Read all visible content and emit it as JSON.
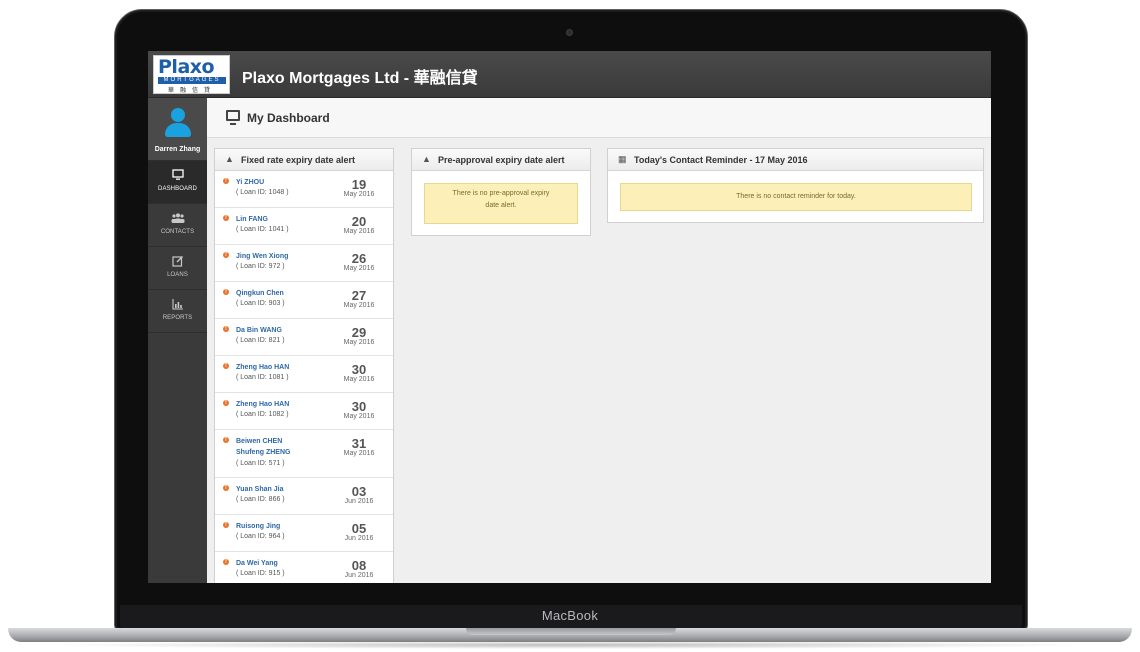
{
  "device": {
    "brand": "MacBook"
  },
  "header": {
    "logo": {
      "word": "Plaxo",
      "sub": "MORTGAGES",
      "cn": "華融信貸"
    },
    "title": "Plaxo Mortgages Ltd - 華融信貸"
  },
  "user": {
    "name": "Darren Zhang"
  },
  "nav": [
    {
      "label": "DASHBOARD",
      "icon": "monitor-icon",
      "active": true
    },
    {
      "label": "CONTACTS",
      "icon": "users-icon",
      "active": false
    },
    {
      "label": "LOANS",
      "icon": "edit-icon",
      "active": false
    },
    {
      "label": "REPORTS",
      "icon": "bar-chart-icon",
      "active": false
    }
  ],
  "page": {
    "title": "My Dashboard"
  },
  "fixed_rate_panel": {
    "title": "Fixed rate expiry date alert",
    "rows": [
      {
        "names": [
          "Yi ZHOU"
        ],
        "loan": "( Loan ID: 1048 )",
        "day": "19",
        "month": "May 2016"
      },
      {
        "names": [
          "Lin FANG"
        ],
        "loan": "( Loan ID: 1041 )",
        "day": "20",
        "month": "May 2016"
      },
      {
        "names": [
          "Jing Wen Xiong"
        ],
        "loan": "( Loan ID: 972 )",
        "day": "26",
        "month": "May 2016"
      },
      {
        "names": [
          "Qingkun Chen"
        ],
        "loan": "( Loan ID: 903 )",
        "day": "27",
        "month": "May 2016"
      },
      {
        "names": [
          "Da Bin WANG"
        ],
        "loan": "( Loan ID: 821 )",
        "day": "29",
        "month": "May 2016"
      },
      {
        "names": [
          "Zheng Hao HAN"
        ],
        "loan": "( Loan ID: 1081 )",
        "day": "30",
        "month": "May 2016"
      },
      {
        "names": [
          "Zheng Hao HAN"
        ],
        "loan": "( Loan ID: 1082 )",
        "day": "30",
        "month": "May 2016"
      },
      {
        "names": [
          "Beiwen CHEN",
          "Shufeng ZHENG"
        ],
        "loan": "( Loan ID: 571 )",
        "day": "31",
        "month": "May 2016"
      },
      {
        "names": [
          "Yuan Shan Jia"
        ],
        "loan": "( Loan ID: 866 )",
        "day": "03",
        "month": "Jun 2016"
      },
      {
        "names": [
          "Ruisong Jing"
        ],
        "loan": "( Loan ID: 964 )",
        "day": "05",
        "month": "Jun 2016"
      },
      {
        "names": [
          "Da Wei Yang"
        ],
        "loan": "( Loan ID: 915 )",
        "day": "08",
        "month": "Jun 2016"
      }
    ]
  },
  "preapproval_panel": {
    "title": "Pre-approval expiry date alert",
    "message_line1": "There is no pre-approval expiry",
    "message_line2": "date alert."
  },
  "contact_panel": {
    "title": "Today's Contact Reminder - 17 May 2016",
    "message": "There is no contact reminder for today."
  },
  "colors": {
    "accent": "#1aa1e0",
    "link": "#2f68a6",
    "warning": "#e8732c",
    "alert_bg": "#fcf0b8"
  }
}
